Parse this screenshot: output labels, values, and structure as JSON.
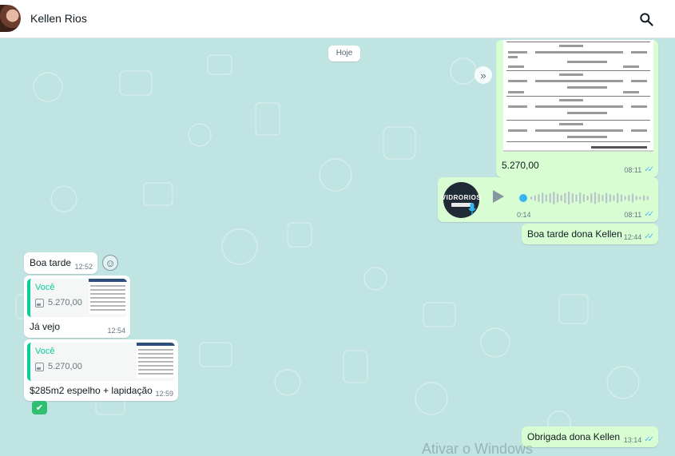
{
  "header": {
    "contact_name": "Kellen Rios",
    "avatar_icon": "contact-avatar",
    "search_icon": "search-icon"
  },
  "chat": {
    "date_label": "Hoje",
    "messages": [
      {
        "direction": "out",
        "type": "image",
        "caption": "5.270,00",
        "time": "08:11",
        "status": "read"
      },
      {
        "direction": "out",
        "type": "voice",
        "brand": "VIDRORIOS",
        "duration": "0:14",
        "time": "08:11",
        "status": "read"
      },
      {
        "direction": "out",
        "type": "text",
        "text": "Boa tarde dona Kellen",
        "time": "12:44",
        "status": "read"
      },
      {
        "direction": "in",
        "type": "text",
        "text": "Boa tarde",
        "time": "12:52"
      },
      {
        "direction": "in",
        "type": "reply",
        "quote_author": "Você",
        "quote_text": "5.270,00",
        "text": "Já vejo",
        "time": "12:54"
      },
      {
        "direction": "in",
        "type": "reply",
        "quote_author": "Você",
        "quote_text": "5.270,00",
        "text": "$285m2 espelho + lapidação",
        "time": "12:59"
      },
      {
        "direction": "out",
        "type": "text",
        "text": "Obrigada dona Kellen",
        "time": "13:14",
        "status": "read"
      }
    ]
  },
  "watermark": "Ativar o Windows",
  "colors": {
    "chat_background": "#c0e4e2",
    "outgoing_bubble": "#d9fdd3",
    "incoming_bubble": "#ffffff",
    "quote_accent": "#06cf9c",
    "read_ticks": "#53bdeb"
  }
}
